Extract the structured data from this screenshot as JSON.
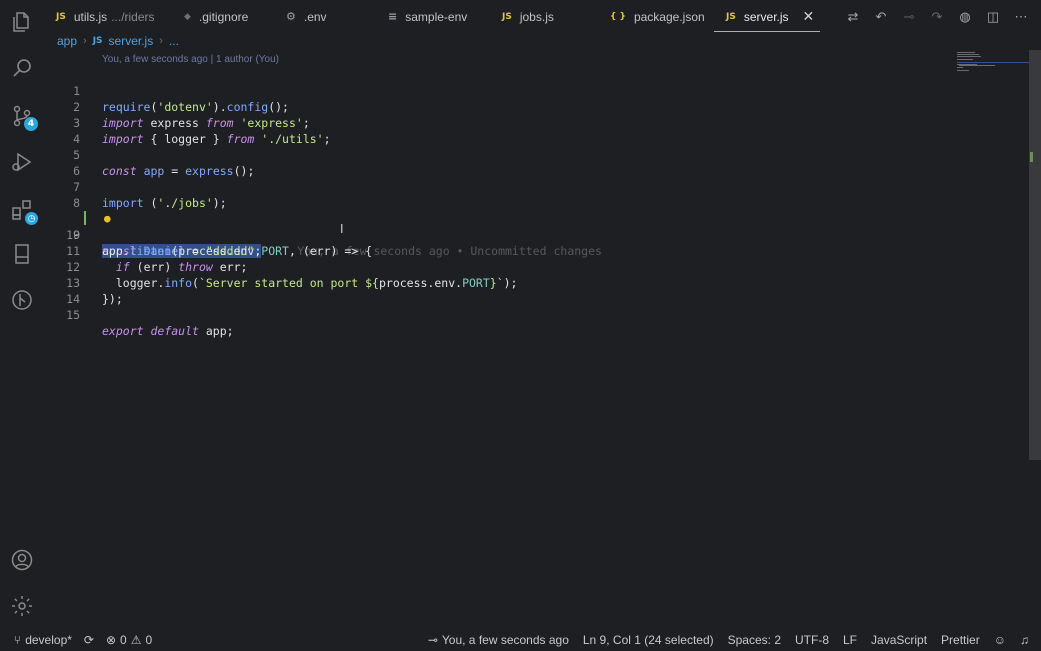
{
  "tabs": [
    {
      "icon": "JS",
      "label": "utils.js",
      "description": ".../riders",
      "icon_color": "#e2c447",
      "active": false
    },
    {
      "icon": "◆",
      "label": ".gitignore",
      "description": "",
      "icon_color": "#7a7a7a",
      "active": false
    },
    {
      "icon": "⚙",
      "label": ".env",
      "description": "",
      "icon_color": "#9aa0a6",
      "active": false
    },
    {
      "icon": "≡",
      "label": "sample-env",
      "description": "",
      "icon_color": "#9aa0a6",
      "active": false
    },
    {
      "icon": "JS",
      "label": "jobs.js",
      "description": "",
      "icon_color": "#e2c447",
      "active": false
    },
    {
      "icon": "{ }",
      "label": "package.json",
      "description": "",
      "icon_color": "#e2c447",
      "active": false
    },
    {
      "icon": "JS",
      "label": "server.js",
      "description": "",
      "icon_color": "#e2c447",
      "active": true
    }
  ],
  "breadcrumb": {
    "folder": "app",
    "file_icon": "JS",
    "file": "server.js",
    "more": "..."
  },
  "codelens": "You, a few seconds ago | 1 author (You)",
  "blame": "You, a few seconds ago • Uncommitted changes",
  "code_lines": [
    {
      "n": "1"
    },
    {
      "n": "2"
    },
    {
      "n": "3"
    },
    {
      "n": "4"
    },
    {
      "n": "5"
    },
    {
      "n": "6"
    },
    {
      "n": "7"
    },
    {
      "n": "8"
    },
    {
      "n": "9"
    },
    {
      "n": "10"
    },
    {
      "n": "11"
    },
    {
      "n": "12"
    },
    {
      "n": "13"
    },
    {
      "n": "14"
    },
    {
      "n": "15"
    }
  ],
  "code": {
    "l1": [
      "require",
      "(",
      "'dotenv'",
      ").",
      "config",
      "();"
    ],
    "l2": [
      "import",
      " express ",
      "from",
      " ",
      "'express'",
      ";"
    ],
    "l3": [
      "import",
      " { logger } ",
      "from",
      " ",
      "'./utils'",
      ";"
    ],
    "l5": [
      "const",
      " ",
      "app",
      " = ",
      "express",
      "();"
    ],
    "l7": [
      "import",
      " (",
      "'./jobs'",
      ");"
    ],
    "l9": [
      "const",
      " ",
      "Daniel",
      " = ",
      "\"ddddd\"",
      ";"
    ],
    "l10": [
      "app",
      ".",
      "listen",
      "(process.env.",
      "PORT",
      ", (err) => {"
    ],
    "l11": [
      "  ",
      "if",
      " (err) ",
      "throw",
      " err;"
    ],
    "l12": [
      "  logger.",
      "info",
      "(",
      "`Server started on port ${",
      "process.env.",
      "PORT",
      "}`",
      ");"
    ],
    "l13": [
      "});"
    ],
    "l15": [
      "export",
      " ",
      "default",
      " app;"
    ]
  },
  "status": {
    "branch": "develop*",
    "errors": "0",
    "warnings": "0",
    "blame": "You, a few seconds ago",
    "position": "Ln 9, Col 1 (24 selected)",
    "spaces": "Spaces: 2",
    "encoding": "UTF-8",
    "eol": "LF",
    "language": "JavaScript",
    "formatter": "Prettier"
  },
  "activity": {
    "scm_badge": "4"
  },
  "colors": {
    "accent": "#2aa7dd",
    "selection": "#34508a",
    "keyword": "#c792ea",
    "string": "#c3e88d"
  }
}
